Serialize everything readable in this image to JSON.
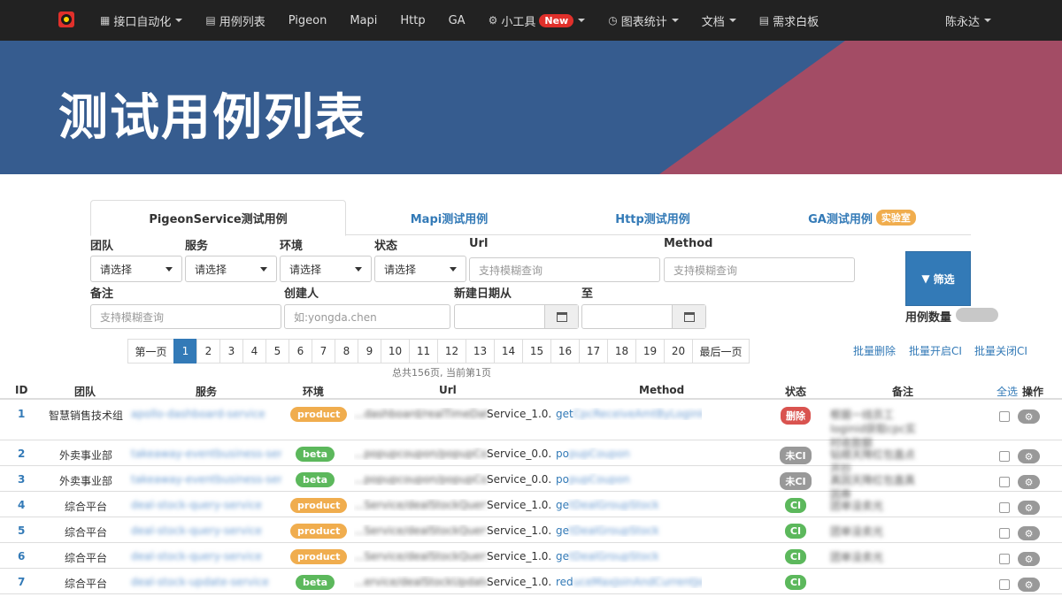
{
  "navbar": {
    "items": [
      {
        "icon": "▦",
        "label": "接口自动化",
        "caret": true
      },
      {
        "icon": "▤",
        "label": "用例列表",
        "caret": false
      },
      {
        "icon": "",
        "label": "Pigeon",
        "caret": false
      },
      {
        "icon": "",
        "label": "Mapi",
        "caret": false
      },
      {
        "icon": "",
        "label": "Http",
        "caret": false
      },
      {
        "icon": "",
        "label": "GA",
        "caret": false
      },
      {
        "icon": "⚙",
        "label": "小工具",
        "caret": true,
        "badge": "New"
      },
      {
        "icon": "◷",
        "label": "图表统计",
        "caret": true
      },
      {
        "icon": "",
        "label": "文档",
        "caret": true
      },
      {
        "icon": "▤",
        "label": "需求白板",
        "caret": false
      }
    ],
    "user": "陈永达"
  },
  "hero": {
    "title": "测试用例列表",
    "colors": {
      "blue": "#365c8f",
      "pink": "#a34c65"
    }
  },
  "tabs": [
    {
      "label": "PigeonService测试用例",
      "active": true
    },
    {
      "label": "Mapi测试用例",
      "active": false
    },
    {
      "label": "Http测试用例",
      "active": false
    },
    {
      "label": "GA测试用例",
      "active": false,
      "badge": "实验室"
    }
  ],
  "filters": {
    "team": {
      "label": "团队",
      "value": "请选择"
    },
    "service": {
      "label": "服务",
      "value": "请选择"
    },
    "env": {
      "label": "环境",
      "value": "请选择"
    },
    "status": {
      "label": "状态",
      "value": "请选择"
    },
    "url": {
      "label": "Url",
      "placeholder": "支持模糊查询"
    },
    "method": {
      "label": "Method",
      "placeholder": "支持模糊查询"
    },
    "remark": {
      "label": "备注",
      "placeholder": "支持模糊查询"
    },
    "creator": {
      "label": "创建人",
      "placeholder": "如:yongda.chen"
    },
    "date_from": {
      "label": "新建日期从"
    },
    "date_to": {
      "label": "至"
    },
    "filter_button": "筛选",
    "count_label": "用例数量"
  },
  "pagination": {
    "first": "第一页",
    "pages": [
      "1",
      "2",
      "3",
      "4",
      "5",
      "6",
      "7",
      "8",
      "9",
      "10",
      "11",
      "12",
      "13",
      "14",
      "15",
      "16",
      "17",
      "18",
      "19",
      "20"
    ],
    "current": "1",
    "last": "最后一页",
    "info": "总共156页, 当前第1页"
  },
  "batch_actions": {
    "delete": "批量删除",
    "enable_ci": "批量开启CI",
    "disable_ci": "批量关闭CI"
  },
  "table": {
    "headers": {
      "id": "ID",
      "team": "团队",
      "service": "服务",
      "env": "环境",
      "url": "Url",
      "method": "Method",
      "status": "状态",
      "remark": "备注",
      "select_all": "全选",
      "action": "操作"
    },
    "rows": [
      {
        "id": "1",
        "team": "智慧销售技术组",
        "service": "apollo-dashboard-service",
        "env": "product",
        "url_prefix": "...dashboard/realTimeData",
        "url_suffix": "Service_1.0.0",
        "method_prefix": "get",
        "method_rest": "CpcReceiveAmtByLoginId",
        "status": "删除",
        "remark": "根据一线员工loginid获取cpc实时收款额"
      },
      {
        "id": "2",
        "team": "外卖事业部",
        "service": "takeaway-eventbusiness-service",
        "env": "beta",
        "url_prefix": "...popupcoupon/popupCoupon",
        "url_suffix": "Service_0.0.1",
        "method_prefix": "po",
        "method_rest": "pupCoupon",
        "status": "未CI",
        "remark": "钻顺天降红包直点开抄"
      },
      {
        "id": "3",
        "team": "外卖事业部",
        "service": "takeaway-eventbusiness-service",
        "env": "beta",
        "url_prefix": "...popupcoupon/popupCoupon",
        "url_suffix": "Service_0.0.1",
        "method_prefix": "po",
        "method_rest": "pupCoupon",
        "status": "未CI",
        "remark": "真因天降红包直真因券"
      },
      {
        "id": "4",
        "team": "综合平台",
        "service": "deal-stock-query-service",
        "env": "product",
        "url_prefix": "...Service/dealStockQuery",
        "url_suffix": "Service_1.0.0",
        "method_prefix": "ge",
        "method_rest": "tDealGroupStock",
        "status": "CI",
        "remark": "团单没卖光"
      },
      {
        "id": "5",
        "team": "综合平台",
        "service": "deal-stock-query-service",
        "env": "product",
        "url_prefix": "...Service/dealStockQuery",
        "url_suffix": "Service_1.0.0",
        "method_prefix": "ge",
        "method_rest": "tDealGroupStock",
        "status": "CI",
        "remark": "团单没卖光"
      },
      {
        "id": "6",
        "team": "综合平台",
        "service": "deal-stock-query-service",
        "env": "product",
        "url_prefix": "...Service/dealStockQuery",
        "url_suffix": "Service_1.0.0",
        "method_prefix": "ge",
        "method_rest": "tDealGroupStock",
        "status": "CI",
        "remark": "团单没卖光"
      },
      {
        "id": "7",
        "team": "综合平台",
        "service": "deal-stock-update-service",
        "env": "beta",
        "url_prefix": "...ervice/dealStockUpdate",
        "url_suffix": "Service_1.0.0",
        "method_prefix": "red",
        "method_rest": "uceMaxJoinAndCurrentJoin",
        "status": "CI",
        "remark": ""
      }
    ]
  },
  "colors": {
    "product": "#f0ad4e",
    "beta": "#5cb85c",
    "status_deleted": "#d9534f",
    "status_no_ci": "#999999",
    "status_ci": "#5cb85c",
    "link": "#337ab7"
  }
}
